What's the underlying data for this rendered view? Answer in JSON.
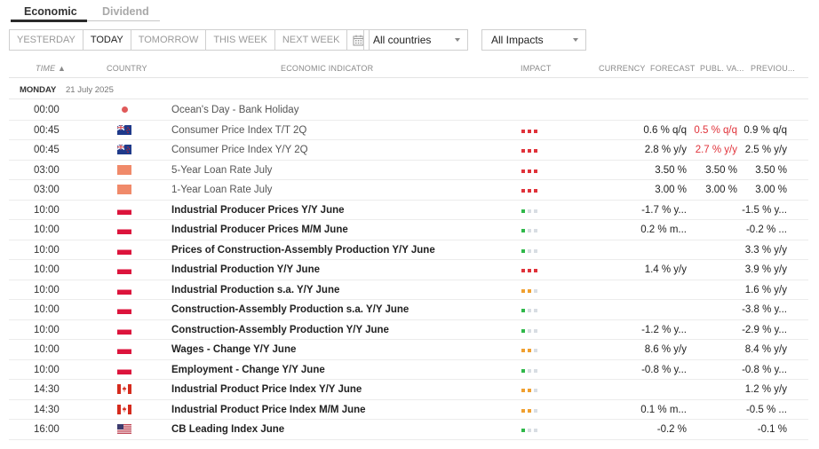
{
  "tabs": [
    {
      "label": "Economic",
      "active": true
    },
    {
      "label": "Dividend",
      "active": false
    }
  ],
  "range": {
    "yesterday": "YESTERDAY",
    "today": "TODAY",
    "tomorrow": "TOMORROW",
    "this_week": "THIS WEEK",
    "next_week": "NEXT WEEK"
  },
  "filters": {
    "countries": "All countries",
    "impacts": "All Impacts"
  },
  "headers": {
    "time": "TIME ▲",
    "country": "COUNTRY",
    "indicator": "ECONOMIC INDICATOR",
    "impact": "IMPACT",
    "currency": "CURRENCY",
    "forecast": "FORECAST",
    "publ": "PUBL. VA...",
    "previous": "PREVIOU..."
  },
  "date_group": {
    "day": "MONDAY",
    "date": "21 July 2025"
  },
  "colors": {
    "impact_high": "#e0323a",
    "impact_medium": "#f0a030",
    "impact_low": "#2fb84a",
    "impact_off": "#d8dde3",
    "negative_red": "#e0323a"
  },
  "rows": [
    {
      "time": "00:00",
      "country": "dot",
      "event": "Ocean's Day - Bank Holiday",
      "bold": false,
      "impact": [],
      "forecast": "",
      "publ": "",
      "previous": "",
      "publ_red": false
    },
    {
      "time": "00:45",
      "country": "nz",
      "event": "Consumer Price Index T/T 2Q",
      "bold": false,
      "impact": [
        "h",
        "h",
        "h"
      ],
      "forecast": "0.6 % q/q",
      "publ": "0.5 % q/q",
      "previous": "0.9 % q/q",
      "publ_red": true
    },
    {
      "time": "00:45",
      "country": "nz",
      "event": "Consumer Price Index Y/Y 2Q",
      "bold": false,
      "impact": [
        "h",
        "h",
        "h"
      ],
      "forecast": "2.8 % y/y",
      "publ": "2.7 % y/y",
      "previous": "2.5 % y/y",
      "publ_red": true
    },
    {
      "time": "03:00",
      "country": "cn",
      "event": "5-Year Loan Rate July",
      "bold": false,
      "impact": [
        "h",
        "h",
        "h"
      ],
      "forecast": "3.50 %",
      "publ": "3.50 %",
      "previous": "3.50 %",
      "publ_red": false
    },
    {
      "time": "03:00",
      "country": "cn",
      "event": "1-Year Loan Rate July",
      "bold": false,
      "impact": [
        "h",
        "h",
        "h"
      ],
      "forecast": "3.00 %",
      "publ": "3.00 %",
      "previous": "3.00 %",
      "publ_red": false
    },
    {
      "time": "10:00",
      "country": "pl",
      "event": "Industrial Producer Prices Y/Y June",
      "bold": true,
      "impact": [
        "l",
        "o",
        "o"
      ],
      "forecast": "-1.7 % y...",
      "publ": "",
      "previous": "-1.5 % y...",
      "publ_red": false
    },
    {
      "time": "10:00",
      "country": "pl",
      "event": "Industrial Producer Prices M/M June",
      "bold": true,
      "impact": [
        "l",
        "o",
        "o"
      ],
      "forecast": "0.2 % m...",
      "publ": "",
      "previous": "-0.2 % ...",
      "publ_red": false
    },
    {
      "time": "10:00",
      "country": "pl",
      "event": "Prices of Construction-Assembly Production Y/Y June",
      "bold": true,
      "impact": [
        "l",
        "o",
        "o"
      ],
      "forecast": "",
      "publ": "",
      "previous": "3.3 % y/y",
      "publ_red": false
    },
    {
      "time": "10:00",
      "country": "pl",
      "event": "Industrial Production Y/Y June",
      "bold": true,
      "impact": [
        "h",
        "h",
        "h"
      ],
      "forecast": "1.4 % y/y",
      "publ": "",
      "previous": "3.9 % y/y",
      "publ_red": false
    },
    {
      "time": "10:00",
      "country": "pl",
      "event": "Industrial Production s.a. Y/Y June",
      "bold": true,
      "impact": [
        "m",
        "m",
        "o"
      ],
      "forecast": "",
      "publ": "",
      "previous": "1.6 % y/y",
      "publ_red": false
    },
    {
      "time": "10:00",
      "country": "pl",
      "event": "Construction-Assembly Production s.a. Y/Y June",
      "bold": true,
      "impact": [
        "l",
        "o",
        "o"
      ],
      "forecast": "",
      "publ": "",
      "previous": "-3.8 % y...",
      "publ_red": false
    },
    {
      "time": "10:00",
      "country": "pl",
      "event": "Construction-Assembly Production Y/Y June",
      "bold": true,
      "impact": [
        "l",
        "o",
        "o"
      ],
      "forecast": "-1.2 % y...",
      "publ": "",
      "previous": "-2.9 % y...",
      "publ_red": false
    },
    {
      "time": "10:00",
      "country": "pl",
      "event": "Wages - Change Y/Y June",
      "bold": true,
      "impact": [
        "m",
        "m",
        "o"
      ],
      "forecast": "8.6 % y/y",
      "publ": "",
      "previous": "8.4 % y/y",
      "publ_red": false
    },
    {
      "time": "10:00",
      "country": "pl",
      "event": "Employment - Change Y/Y June",
      "bold": true,
      "impact": [
        "l",
        "o",
        "o"
      ],
      "forecast": "-0.8 % y...",
      "publ": "",
      "previous": "-0.8 % y...",
      "publ_red": false
    },
    {
      "time": "14:30",
      "country": "ca",
      "event": "Industrial Product Price Index Y/Y June",
      "bold": true,
      "impact": [
        "m",
        "m",
        "o"
      ],
      "forecast": "",
      "publ": "",
      "previous": "1.2 % y/y",
      "publ_red": false
    },
    {
      "time": "14:30",
      "country": "ca",
      "event": "Industrial Product Price Index M/M June",
      "bold": true,
      "impact": [
        "m",
        "m",
        "o"
      ],
      "forecast": "0.1 % m...",
      "publ": "",
      "previous": "-0.5 % ...",
      "publ_red": false
    },
    {
      "time": "16:00",
      "country": "us",
      "event": "CB Leading Index June",
      "bold": true,
      "impact": [
        "l",
        "o",
        "o"
      ],
      "forecast": "-0.2 %",
      "publ": "",
      "previous": "-0.1 %",
      "publ_red": false
    }
  ]
}
